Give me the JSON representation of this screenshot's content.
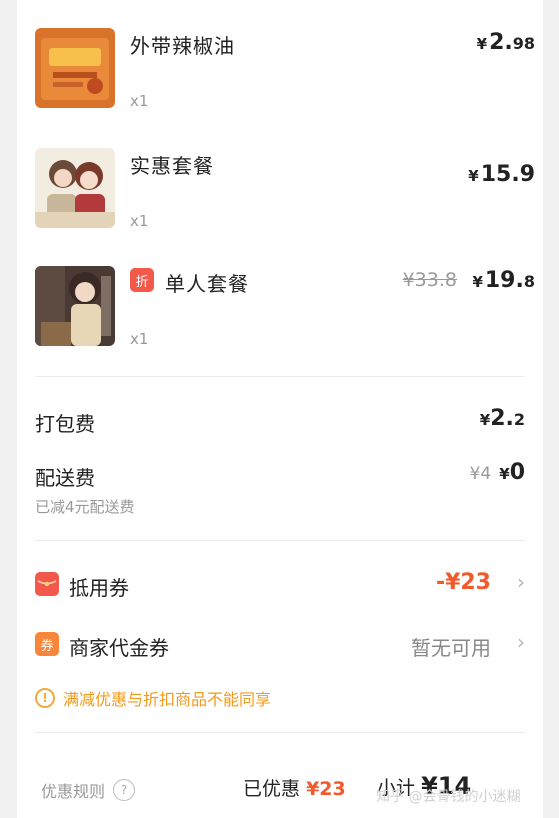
{
  "items": [
    {
      "name": "外带辣椒油",
      "qty": "x1",
      "price_yen": "¥",
      "price_int": "2.",
      "price_dec": "98",
      "thumb": "chili-oil-packet"
    },
    {
      "name": "实惠套餐",
      "qty": "x1",
      "price_yen": "¥",
      "price_int": "15.",
      "price_dec": "9",
      "thumb": "couple-illustration"
    },
    {
      "name": "单人套餐",
      "qty": "x1",
      "badge": "折",
      "orig_price": "¥33.8",
      "price_yen": "¥",
      "price_int": "19.",
      "price_dec": "8",
      "thumb": "girl-illustration"
    }
  ],
  "fees": {
    "packing_label": "打包费",
    "packing_yen": "¥",
    "packing_int": "2.",
    "packing_dec": "2",
    "delivery_label": "配送费",
    "delivery_orig": "¥4",
    "delivery_yen": "¥",
    "delivery_value": "0",
    "delivery_sub": "已减4元配送费"
  },
  "coupons": {
    "voucher_label": "抵用券",
    "voucher_icon": "red-envelope-icon",
    "voucher_value": "-¥23",
    "merchant_label": "商家代金券",
    "merchant_icon_text": "券",
    "merchant_value": "暂无可用"
  },
  "notice": "满减优惠与折扣商品不能同享",
  "footer": {
    "rules_label": "优惠规则",
    "rules_help": "?",
    "saved_label": "已优惠",
    "saved_value": "¥23",
    "subtotal_label": "小计",
    "subtotal_value": "¥14"
  },
  "watermark": "知乎 @会骨钱的小迷糊",
  "colors": {
    "accent": "#f25a2c",
    "badge": "#f2594b",
    "notice": "#f29a1b",
    "muted": "#999999"
  }
}
